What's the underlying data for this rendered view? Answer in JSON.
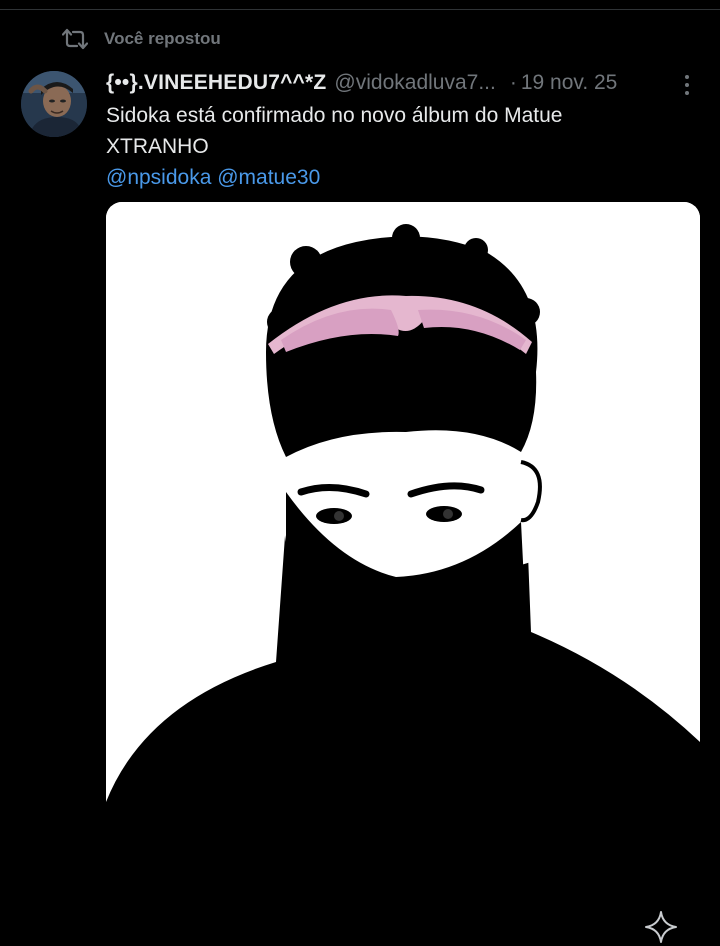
{
  "repost_banner": {
    "icon": "repost-icon",
    "label": "Você repostou"
  },
  "tweet": {
    "author": {
      "display_name": "{••}.VINEEHEDU7^^*Z",
      "handle": "@vidokadluva7...",
      "avatar": "profile-photo"
    },
    "separator": "·",
    "date": "19 nov. 25",
    "more_icon": "more-vertical-icon",
    "text_line1": "Sidoka está confirmado no novo álbum do Matue",
    "text_line2": "XTRANHO",
    "mentions": [
      "@npsidoka",
      "@matue30"
    ],
    "media": {
      "kind": "photo"
    }
  },
  "floating_icon": "sparkle-icon",
  "colors": {
    "background": "#000000",
    "text_primary": "#e7e9ea",
    "text_secondary": "#71767b",
    "link": "#4a99e9",
    "divider": "#2f3336"
  }
}
